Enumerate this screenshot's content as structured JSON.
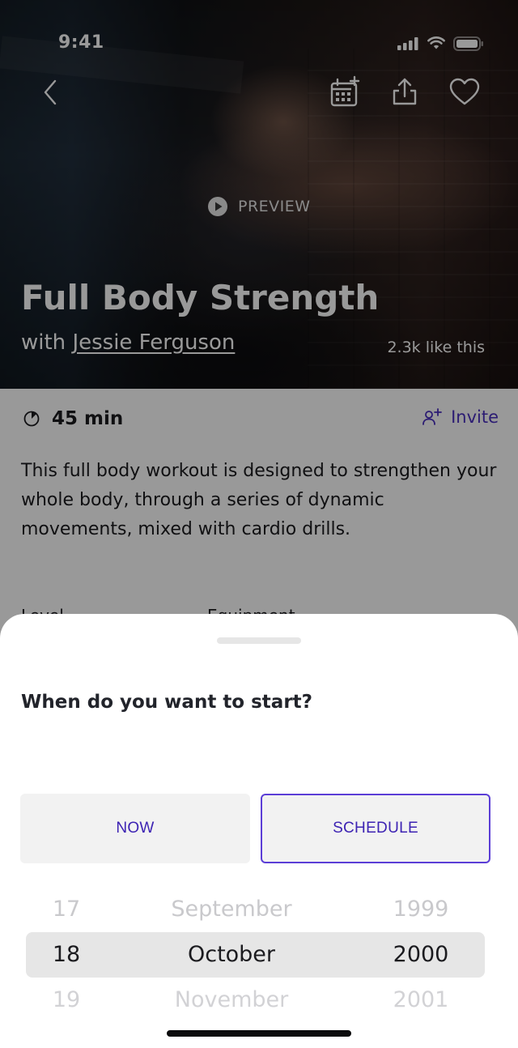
{
  "status_bar": {
    "time": "9:41"
  },
  "hero": {
    "preview_label": "PREVIEW",
    "title": "Full Body Strength",
    "with_prefix": "with",
    "trainer": "Jessie Ferguson",
    "likes": "2.3k like this"
  },
  "details": {
    "duration": "45 min",
    "invite_label": "Invite",
    "description": "This full body workout is designed to strengthen your whole body, through a series of dynamic movements, mixed with cardio drills.",
    "peek_left": "Level",
    "peek_right": "Equipment"
  },
  "sheet": {
    "title": "When do you want to start?",
    "now_label": "NOW",
    "schedule_label": "SCHEDULE",
    "picker": {
      "prev": {
        "day": "17",
        "month": "September",
        "year": "1999"
      },
      "selected": {
        "day": "18",
        "month": "October",
        "year": "2000"
      },
      "next": {
        "day": "19",
        "month": "November",
        "year": "2001"
      }
    }
  },
  "colors": {
    "accent": "#3d23b3",
    "schedule_border": "#5b3ed6",
    "button_bg": "#f2f2f2",
    "picker_band": "#e6e6e6"
  }
}
